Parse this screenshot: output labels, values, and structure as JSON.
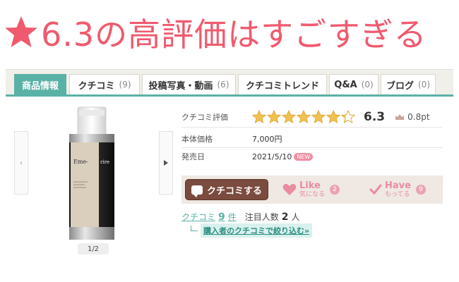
{
  "headline": {
    "text": "6.3の高評価はすごすぎる",
    "star_color": "#f05a6e"
  },
  "tabs": [
    {
      "label": "商品情報",
      "count": "",
      "active": true
    },
    {
      "label": "クチコミ",
      "count": "(9)"
    },
    {
      "label": "投稿写真・動画",
      "count": "(6)"
    },
    {
      "label": "クチコミトレンド",
      "count": ""
    },
    {
      "label": "Q&A",
      "count": "(0)"
    },
    {
      "label": "ブログ",
      "count": "(0)"
    }
  ],
  "gallery": {
    "pager": "1/2",
    "prev_icon": "chevron-left-icon",
    "next_icon": "chevron-right-icon",
    "product_label": "Eme-rire"
  },
  "info": {
    "rating_label": "クチコミ評価",
    "rating_value": 6.3,
    "rating_max": 7,
    "rating_score": "6.3",
    "points": "0.8pt",
    "price_label": "本体価格",
    "price_value": "7,000円",
    "release_label": "発売日",
    "release_value": "2021/5/10",
    "new_badge": "NEW"
  },
  "actions": {
    "review_button": "クチコミする",
    "like_label": "Like",
    "like_sub": "気になる",
    "like_count": "2",
    "have_label": "Have",
    "have_sub": "もってる",
    "have_count": "9"
  },
  "summary": {
    "review_link": "クチコミ",
    "review_count": "9",
    "review_unit": "件",
    "attention_label": "注目人数",
    "attention_count": "2",
    "attention_unit": "人",
    "filter_link": "購入者のクチコミで絞り込む",
    "filter_suffix": "»"
  },
  "colors": {
    "accent": "#5ab1a6",
    "pink": "#f05a6e",
    "button_brown": "#7a4b3e",
    "star_gold": "#f2c14e"
  }
}
